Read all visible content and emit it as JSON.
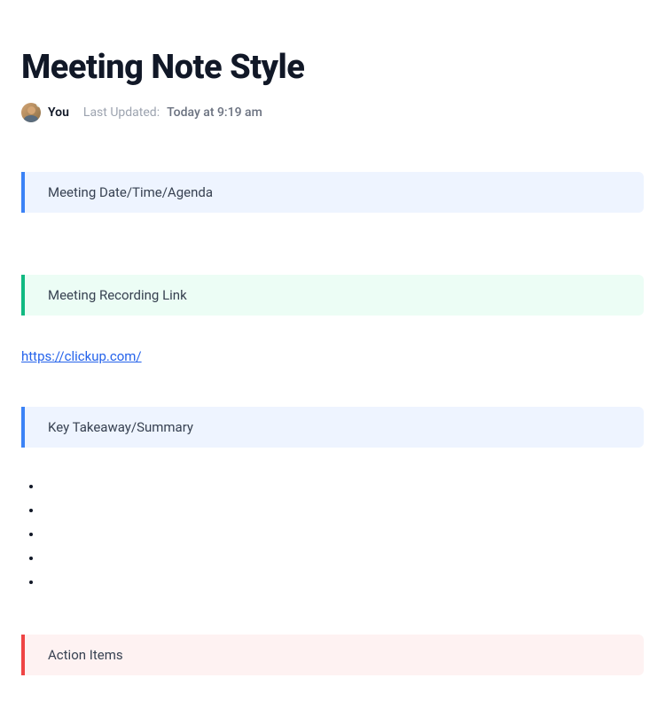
{
  "title": "Meeting Note Style",
  "meta": {
    "author": "You",
    "updated_label": "Last Updated:",
    "updated_time": "Today at 9:19 am"
  },
  "sections": {
    "date_agenda": {
      "label": "Meeting Date/Time/Agenda",
      "accent": "blue"
    },
    "recording": {
      "label": "Meeting Recording Link",
      "accent": "green"
    },
    "takeaways": {
      "label": "Key Takeaway/Summary",
      "accent": "blue"
    },
    "actions": {
      "label": "Action Items",
      "accent": "red"
    }
  },
  "recording_link": "https://clickup.com/",
  "takeaway_items": [
    "",
    "",
    "",
    "",
    ""
  ]
}
